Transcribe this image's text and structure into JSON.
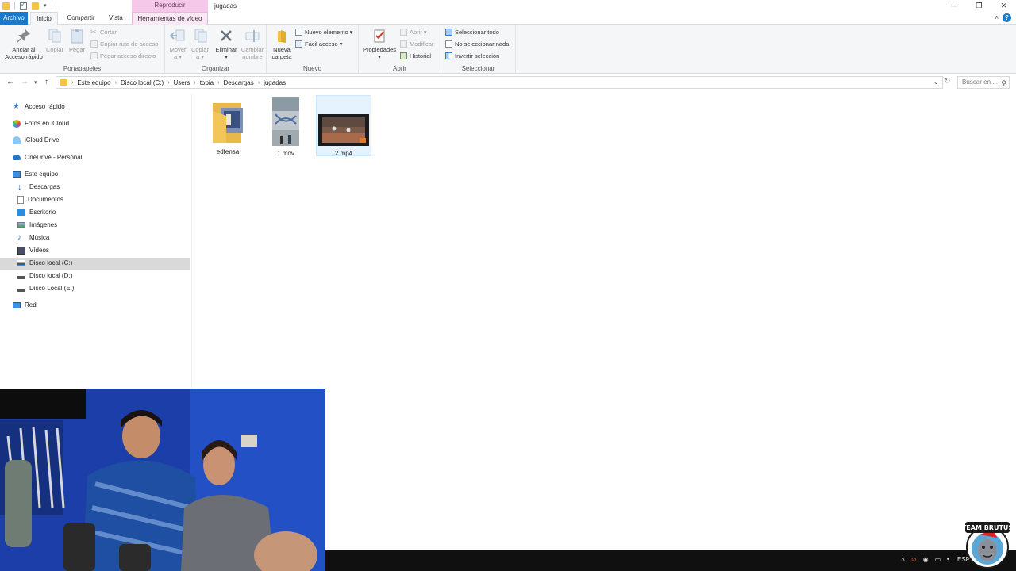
{
  "window": {
    "title": "jugadas",
    "context_tab_header": "Reproducir",
    "controls": [
      "—",
      "❐",
      "✕"
    ]
  },
  "tabs": {
    "file": "Archivo",
    "home": "Inicio",
    "share": "Compartir",
    "view": "Vista",
    "video_tools": "Herramientas de vídeo"
  },
  "ribbon": {
    "clipboard": {
      "label": "Portapapeles",
      "pin": "Anclar al\nAcceso rápido",
      "copy": "Copiar",
      "paste": "Pegar",
      "cut": "Cortar",
      "copy_path": "Copiar ruta de acceso",
      "paste_shortcut": "Pegar acceso directo"
    },
    "organize": {
      "label": "Organizar",
      "move": "Mover\na ▾",
      "copy_to": "Copiar\na ▾",
      "delete": "Eliminar\n▾",
      "rename": "Cambiar\nnombre"
    },
    "new": {
      "label": "Nuevo",
      "new_folder": "Nueva\ncarpeta",
      "new_item": "Nuevo elemento ▾",
      "easy_access": "Fácil acceso ▾"
    },
    "open": {
      "label": "Abrir",
      "properties": "Propiedades\n▾",
      "open": "Abrir ▾",
      "edit": "Modificar",
      "history": "Historial"
    },
    "select": {
      "label": "Seleccionar",
      "select_all": "Seleccionar todo",
      "select_none": "No seleccionar nada",
      "invert": "Invertir selección"
    }
  },
  "address": {
    "crumbs": [
      "Este equipo",
      "Disco local (C:)",
      "Users",
      "tobia",
      "Descargas",
      "jugadas"
    ],
    "search_placeholder": "Buscar en ..."
  },
  "nav": {
    "quick_access": "Acceso rápido",
    "icloud_photos": "Fotos en iCloud",
    "icloud_drive": "iCloud Drive",
    "onedrive": "OneDrive - Personal",
    "this_pc": "Este equipo",
    "downloads": "Descargas",
    "documents": "Documentos",
    "desktop": "Escritorio",
    "pictures": "Imágenes",
    "music": "Música",
    "videos": "Vídeos",
    "disk_c": "Disco local (C:)",
    "disk_d": "Disco local (D:)",
    "disk_e": "Disco Local (E:)",
    "network": "Red"
  },
  "files": [
    {
      "name": "edfensa",
      "kind": "folder"
    },
    {
      "name": "1.mov",
      "kind": "video"
    },
    {
      "name": "2.mp4",
      "kind": "video",
      "selected": true
    }
  ],
  "taskbar": {
    "language": "ESP"
  },
  "logo": {
    "text": "TEAM BRUTUS"
  }
}
